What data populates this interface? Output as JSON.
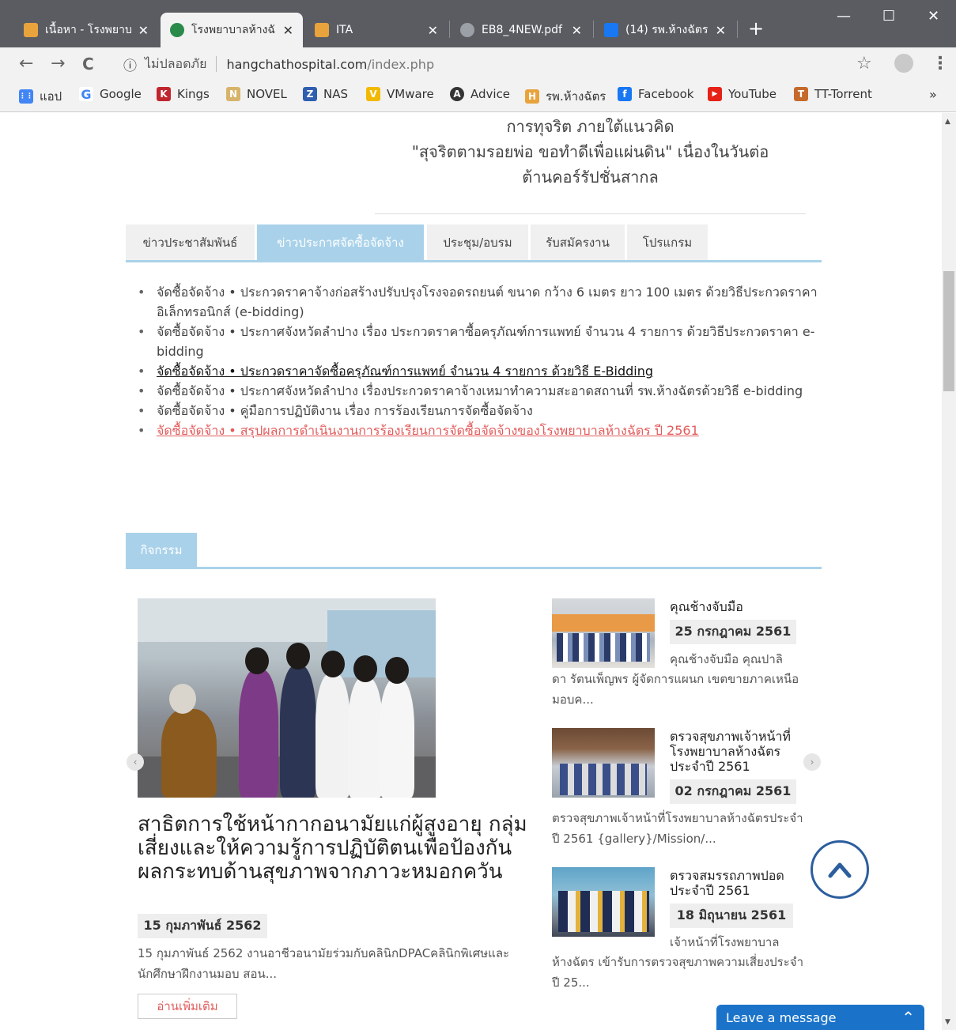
{
  "browser": {
    "tabs": [
      {
        "title": "เนื้อหา - โรงพยาบ",
        "color": "#e8a33d"
      },
      {
        "title": "โรงพยาบาลห้างฉั",
        "color": "#2a8a4a"
      },
      {
        "title": "ITA",
        "color": "#e8a33d"
      },
      {
        "title": "EB8_4NEW.pdf",
        "color": "#9aa0a6"
      },
      {
        "title": "(14) รพ.ห้างฉัตร",
        "color": "#1877f2"
      }
    ],
    "close_glyph": "✕",
    "new_tab_glyph": "+",
    "window_controls": {
      "minimize": "—",
      "maximize": "☐",
      "close": "✕"
    },
    "nav": {
      "back": "←",
      "forward": "→",
      "reload": "C"
    },
    "address": {
      "security_icon": "ⓘ",
      "security_label": "ไม่ปลอดภัย",
      "host": "hangchathospital.com",
      "path": "/index.php"
    },
    "star_glyph": "☆",
    "menu_glyph": "⋮",
    "bookmarks": [
      {
        "label": "แอป",
        "icon": "apps-icon",
        "color": "#4285f4",
        "glyph": "⋮⋮"
      },
      {
        "label": "Google",
        "icon": "google-icon",
        "color": "#4285f4",
        "glyph": "G"
      },
      {
        "label": "Kings",
        "icon": "kings-icon",
        "color": "#c0262d",
        "glyph": "K"
      },
      {
        "label": "NOVEL",
        "icon": "novel-icon",
        "color": "#d8b36a",
        "glyph": "N"
      },
      {
        "label": "NAS",
        "icon": "nas-icon",
        "color": "#2f5fae",
        "glyph": "Z"
      },
      {
        "label": "VMware",
        "icon": "vmware-icon",
        "color": "#f2b900",
        "glyph": "V"
      },
      {
        "label": "Advice",
        "icon": "advice-icon",
        "color": "#333333",
        "glyph": "A"
      },
      {
        "label": "รพ.ห้างฉัตร",
        "icon": "hospital-icon",
        "color": "#e8a33d",
        "glyph": "H"
      },
      {
        "label": "Facebook",
        "icon": "facebook-icon",
        "color": "#1877f2",
        "glyph": "f"
      },
      {
        "label": "YouTube",
        "icon": "youtube-icon",
        "color": "#e62117",
        "glyph": "▶"
      },
      {
        "label": "TT-Torrent",
        "icon": "torrent-icon",
        "color": "#c56a2b",
        "glyph": "T"
      }
    ],
    "bookmarks_more": "»"
  },
  "intro_lines": [
    "การทุจริต ภายใต้แนวคิด",
    "\"สุจริตตามรอยพ่อ ขอทำดีเพื่อแผ่นดิน\" เนื่องในวันต่อ",
    "ต้านคอร์รัปชั่นสากล"
  ],
  "news_tabs": [
    {
      "label": "ข่าวประชาสัมพันธ์"
    },
    {
      "label": "ข่าวประกาศจัดซื้อจัดจ้าง"
    },
    {
      "label": "ประชุม/อบรม"
    },
    {
      "label": "รับสมัครงาน"
    },
    {
      "label": "โปรแกรม"
    }
  ],
  "news_items": [
    {
      "text": "จัดซื้อจัดจ้าง • ประกวดราคาจ้างก่อสร้างปรับปรุงโรงจอดรถยนต์ ขนาด กว้าง 6 เมตร ยาว 100 เมตร ด้วยวิธีประกวดราคาอิเล็กทรอนิกส์ (e-bidding)"
    },
    {
      "text": "จัดซื้อจัดจ้าง • ประกาศจังหวัดลำปาง เรื่อง ประกวดราคาซื้อครุภัณฑ์การแพทย์ จำนวน 4 รายการ ด้วยวิธีประกวดราคา e-bidding"
    },
    {
      "text": "จัดซื้อจัดจ้าง • ประกวดราคาจัดซื้อครุภัณฑ์การแพทย์ จำนวน 4 รายการ ด้วยวิธี E-Bidding"
    },
    {
      "text": "จัดซื้อจัดจ้าง • ประกาศจังหวัดลำปาง เรื่องประกวดราคาจ้างเหมาทำความสะอาดสถานที่ รพ.ห้างฉัตรด้วยวิธี e-bidding"
    },
    {
      "text": "จัดซื้อจัดจ้าง • คู่มือการปฏิบัติงาน เรื่อง การร้องเรียนการจัดซื้อจัดจ้าง"
    },
    {
      "text": "จัดซื้อจัดจ้าง • สรุปผลการดำเนินงานการร้องเรียนการจัดซื้อจัดจ้างของโรงพยาบาลห้างฉัตร ปี 2561"
    }
  ],
  "activities": {
    "tab_label": "กิจกรรม",
    "main": {
      "title": "สาธิตการใช้หน้ากากอนามัยแก่ผู้สูงอายุ กลุ่มเสี่ยงและให้ความรู้การปฏิบัติตนเพื่อป้องกันผลกระทบด้านสุขภาพจากภาวะหมอกควัน",
      "date": "15 กุมภาพันธ์ 2562",
      "excerpt": "15 กุมภาพันธ์ 2562 งานอาชีวอนามัยร่วมกับคลินิกDPACคลินิกพิเศษและนักศึกษาฝึกงานมอบ สอน...",
      "read_more": "อ่านเพิ่มเติม"
    },
    "side": [
      {
        "title": "คุณช้างจับมือ",
        "date": "25 กรกฎาคม 2561",
        "excerpt_first": "คุณช้างจับมือ คุณปาลิ",
        "excerpt_rest": "ดา รัตนเพ็ญพร ผู้จัดการแผนก เขตขายภาคเหนือ มอบค..."
      },
      {
        "title": "ตรวจสุขภาพเจ้าหน้าที่โรงพยาบาลห้างฉัตร ประจำปี 2561",
        "date": "02 กรกฎาคม 2561",
        "excerpt_rest": "ตรวจสุขภาพเจ้าหน้าที่โรงพยาบาลห้างฉัตรประจำปี 2561 {gallery}/Mission/..."
      },
      {
        "title": "ตรวจสมรรถภาพปอด ประจำปี 2561",
        "date": "18 มิถุนายน 2561",
        "excerpt_first": "เจ้าหน้าที่โรงพยาบาล",
        "excerpt_rest": "ห้างฉัตร เข้ารับการตรวจสุขภาพความเสี่ยงประจำปี 25..."
      }
    ],
    "prev_glyph": "‹",
    "next_glyph": "›"
  },
  "chat": {
    "label": "Leave a message",
    "chevron": "⌃"
  },
  "colors": {
    "accent_tab": "#a9d2ea",
    "link_red": "#e25b5b",
    "chat_blue": "#1a73c9",
    "backtop_blue": "#2c5e9e"
  }
}
